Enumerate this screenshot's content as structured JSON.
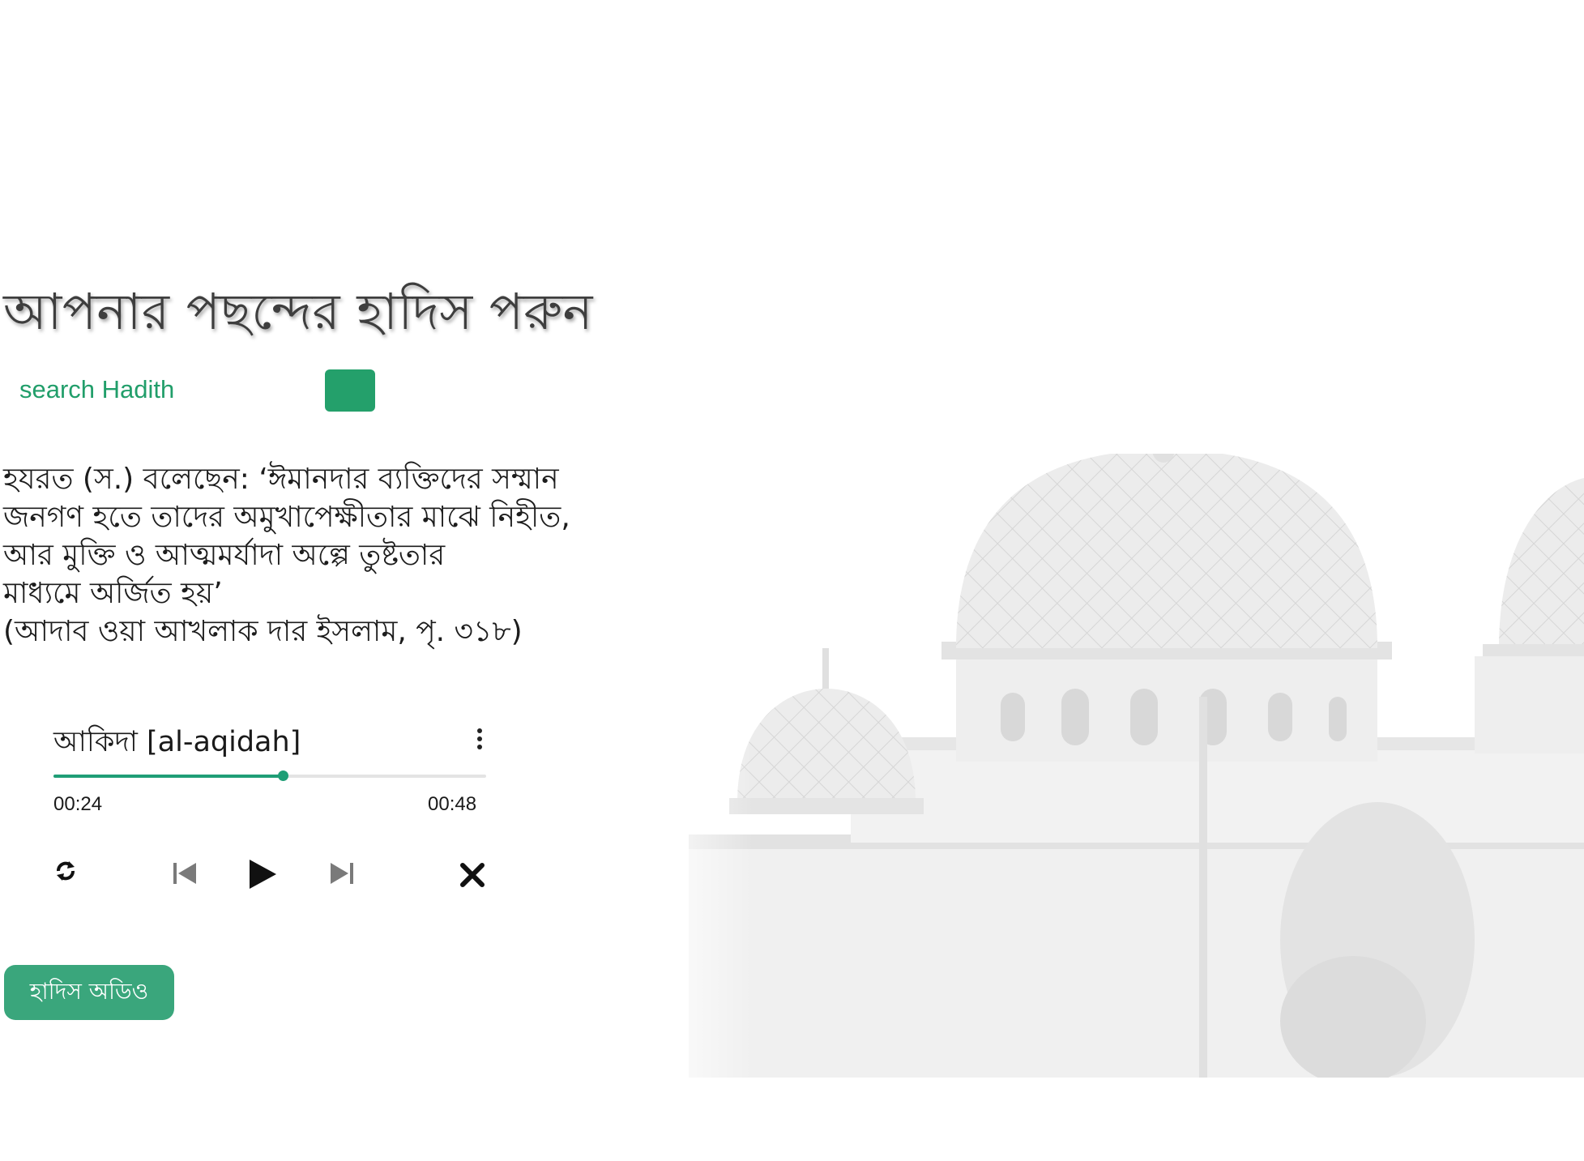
{
  "page": {
    "title": "আপনার পছন্দের হাদিস পরুন"
  },
  "search": {
    "placeholder": "search Hadith",
    "button_label": ""
  },
  "hadith": {
    "lines": [
      "হযরত (স.) বলেছেন: ‘ঈমানদার ব্যক্তিদের সম্মান",
      "জনগণ হতে তাদের অমুখাপেক্ষীতার মাঝে নিহীত,",
      "আর মুক্তি ও আত্মমর্যাদা অল্পে তুষ্টতার",
      "মাধ্যমে অর্জিত হয়’",
      "(আদাব ওয়া আখলাক দার ইসলাম, পৃ. ৩১৮)"
    ]
  },
  "player": {
    "track_title": "আকিদা [al-aqidah]",
    "current_time": "00:24",
    "total_time": "00:48",
    "progress": 0.53,
    "icons": {
      "menu": "more-vertical-icon",
      "repeat": "repeat-icon",
      "previous": "skip-previous-icon",
      "play": "play-icon",
      "next": "skip-next-icon",
      "close": "close-icon"
    }
  },
  "audio_button": {
    "label": "হাদিস অডিও"
  },
  "colors": {
    "accent": "#24a06b",
    "progress": "#1f9e76",
    "audio_button": "#3aa67c",
    "title_text": "#3e3e3e"
  }
}
